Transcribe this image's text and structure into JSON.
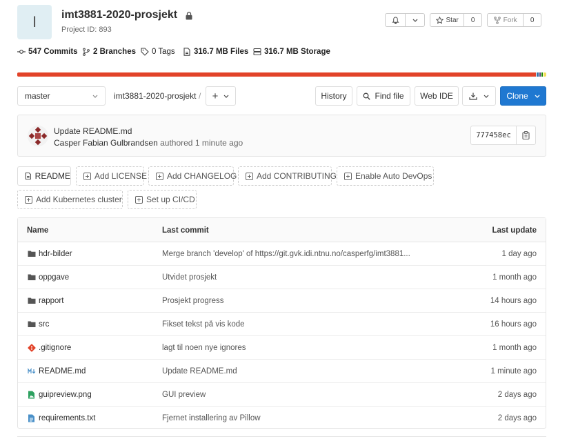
{
  "project": {
    "avatar_letter": "I",
    "title": "imt3881-2020-prosjekt",
    "id_label": "Project ID: 893"
  },
  "actions": {
    "star_label": "Star",
    "star_count": "0",
    "fork_label": "Fork",
    "fork_count": "0"
  },
  "stats": {
    "commits": "547 Commits",
    "branches": "2 Branches",
    "tags": "0 Tags",
    "files": "316.7 MB Files",
    "storage": "316.7 MB Storage"
  },
  "language_bar": [
    {
      "color": "#e24329",
      "share": 0.985
    },
    {
      "color": "#3572a5",
      "share": 0.004
    },
    {
      "color": "#563d7c",
      "share": 0.003
    },
    {
      "color": "#178600",
      "share": 0.003
    },
    {
      "color": "#f1e05a",
      "share": 0.005
    }
  ],
  "toolbar": {
    "branch": "master",
    "path_root": "imt3881-2020-prosjekt",
    "path_sep": "/",
    "add_label": "+",
    "history": "History",
    "find_file": "Find file",
    "web_ide": "Web IDE",
    "clone": "Clone"
  },
  "last_commit": {
    "message": "Update README.md",
    "author": "Casper Fabian Gulbrandsen",
    "authored": "authored 1 minute ago",
    "sha": "777458ec"
  },
  "quick_actions": [
    {
      "label": "README",
      "style": "solid"
    },
    {
      "label": "Add LICENSE",
      "style": "dashed"
    },
    {
      "label": "Add CHANGELOG",
      "style": "dashed"
    },
    {
      "label": "Add CONTRIBUTING",
      "style": "dashed"
    },
    {
      "label": "Enable Auto DevOps",
      "style": "dashed"
    },
    {
      "label": "Add Kubernetes cluster",
      "style": "dashed"
    },
    {
      "label": "Set up CI/CD",
      "style": "dashed"
    }
  ],
  "files": {
    "headers": {
      "name": "Name",
      "last_commit": "Last commit",
      "last_update": "Last update"
    },
    "rows": [
      {
        "name": "hdr-bilder",
        "icon": "folder-icon",
        "commit": "Merge branch 'develop' of https://git.gvk.idi.ntnu.no/casperfg/imt3881...",
        "updated": "1 day ago"
      },
      {
        "name": "oppgave",
        "icon": "folder-icon",
        "commit": "Utvidet prosjekt",
        "updated": "1 month ago"
      },
      {
        "name": "rapport",
        "icon": "folder-icon",
        "commit": "Prosjekt progress",
        "updated": "14 hours ago"
      },
      {
        "name": "src",
        "icon": "folder-icon",
        "commit": "Fikset tekst på vis kode",
        "updated": "16 hours ago"
      },
      {
        "name": ".gitignore",
        "icon": "git-icon",
        "commit": "lagt til noen nye ignores",
        "updated": "1 month ago"
      },
      {
        "name": "README.md",
        "icon": "markdown-icon",
        "commit": "Update README.md",
        "updated": "1 minute ago"
      },
      {
        "name": "guipreview.png",
        "icon": "image-file-icon",
        "commit": "GUI preview",
        "updated": "2 days ago"
      },
      {
        "name": "requirements.txt",
        "icon": "text-file-icon",
        "commit": "Fjernet installering av Pillow",
        "updated": "2 days ago"
      }
    ]
  }
}
